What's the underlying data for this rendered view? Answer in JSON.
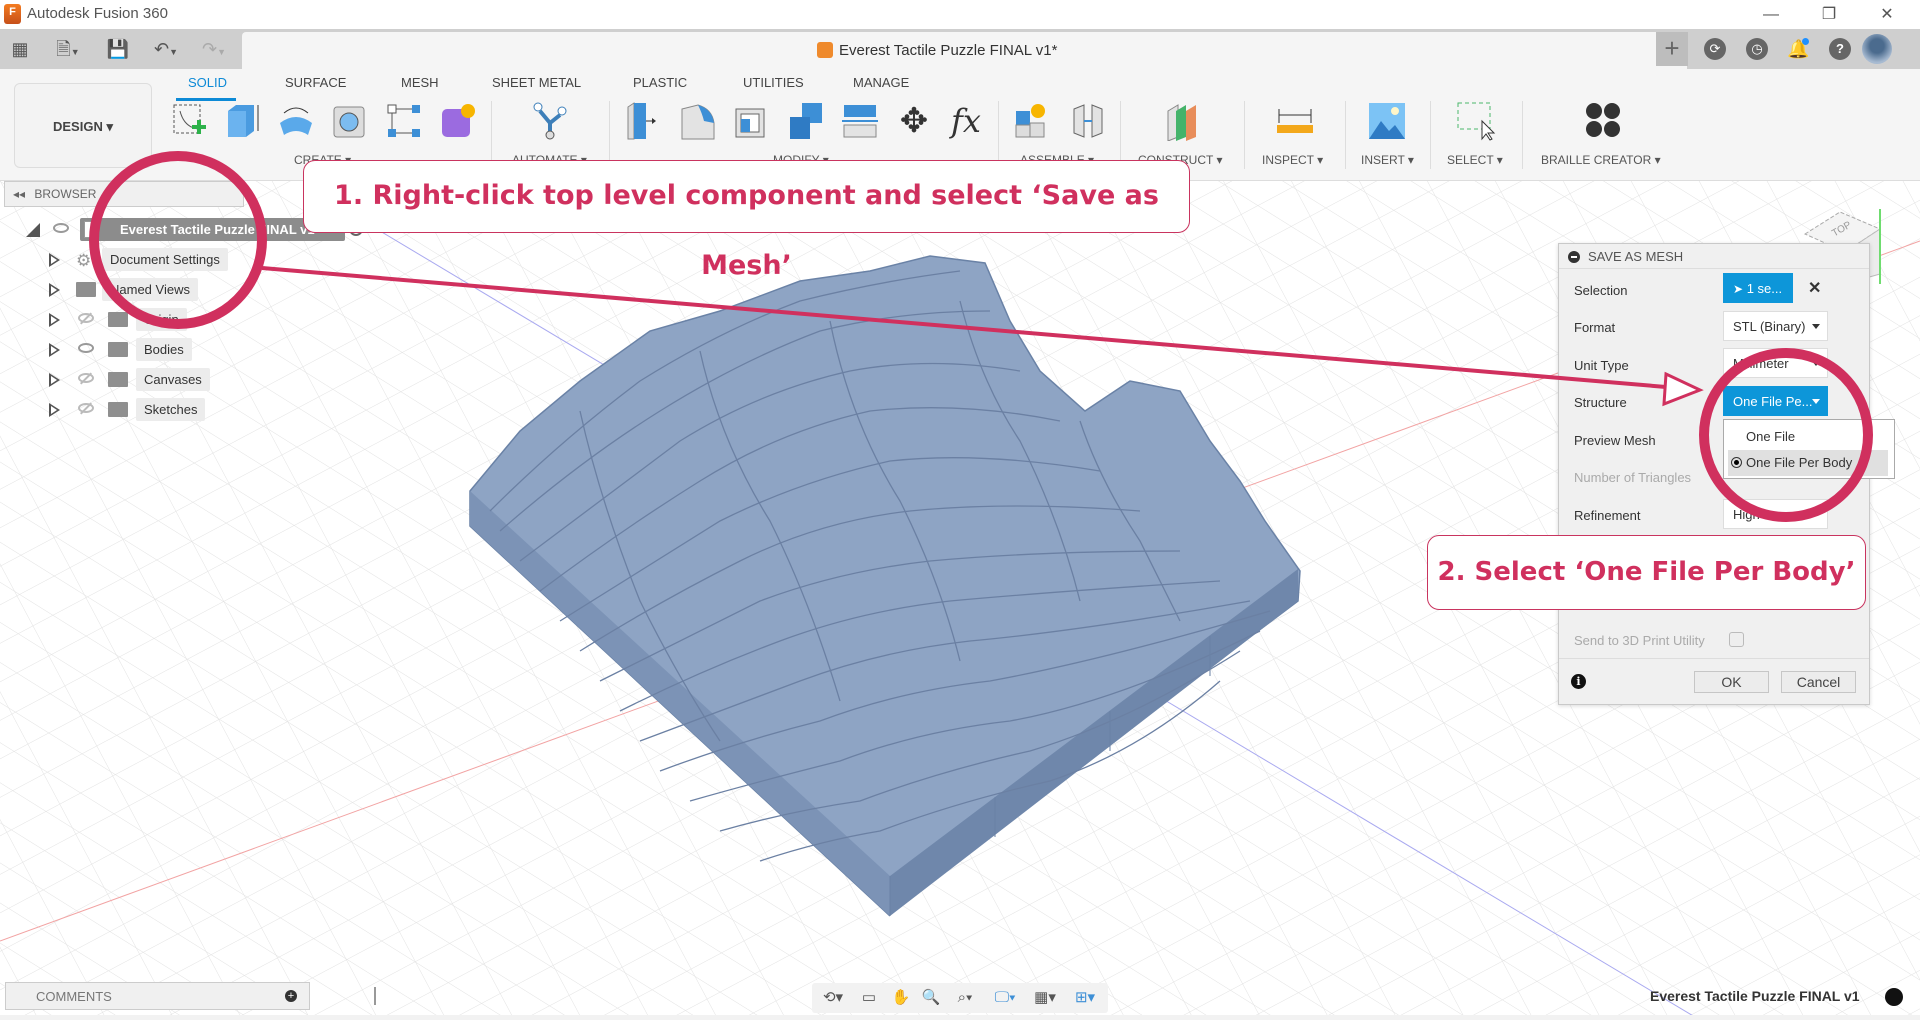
{
  "app": {
    "title": "Autodesk Fusion 360",
    "app_icon_letter": "F"
  },
  "window_controls": {
    "minimize": "—",
    "restore": "❐",
    "close": "✕"
  },
  "tabstrip": {
    "grid_icon": "▦",
    "file_icon": "🗎",
    "save_icon": "💾",
    "undo_icon": "↶",
    "redo_icon": "↷",
    "document_title": "Everest Tactile Puzzle FINAL v1*",
    "close_tab": "✕",
    "new_tab": "+",
    "right_icons": [
      "extensions-icon",
      "job-status-icon",
      "notifications-icon",
      "help-icon",
      "profile-avatar"
    ],
    "help_glyph": "?",
    "notification_color": "#1e90ff"
  },
  "ribbon": {
    "workspace_button": "DESIGN ▾",
    "tabs": [
      {
        "label": "SOLID",
        "active": true
      },
      {
        "label": "SURFACE",
        "active": false
      },
      {
        "label": "MESH",
        "active": false
      },
      {
        "label": "SHEET METAL",
        "active": false
      },
      {
        "label": "PLASTIC",
        "active": false
      },
      {
        "label": "UTILITIES",
        "active": false
      },
      {
        "label": "MANAGE",
        "active": false
      }
    ],
    "groups": {
      "create": "CREATE ▾",
      "automate": "AUTOMATE ▾",
      "modify": "MODIFY ▾",
      "assemble": "ASSEMBLE ▾",
      "construct": "CONSTRUCT ▾",
      "inspect": "INSPECT ▾",
      "insert": "INSERT ▾",
      "select": "SELECT ▾",
      "braille_creator": "BRAILLE CREATOR ▾"
    },
    "modify_fx_label": "fx",
    "accent_color": "#0d8ad6"
  },
  "browser": {
    "header": "BROWSER",
    "collapse_glyph": "◂◂",
    "root": "Everest Tactile Puzzle FINAL v1",
    "items": [
      {
        "label": "Document Settings",
        "visible": null
      },
      {
        "label": "Named Views",
        "visible": null
      },
      {
        "label": "Origin",
        "visible": false
      },
      {
        "label": "Bodies",
        "visible": true
      },
      {
        "label": "Canvases",
        "visible": false
      },
      {
        "label": "Sketches",
        "visible": false
      }
    ]
  },
  "viewcube": {
    "face_label": "TOP"
  },
  "dialog": {
    "title": "SAVE AS MESH",
    "rows": [
      {
        "label": "Selection",
        "value": "1 se...",
        "type": "selection"
      },
      {
        "label": "Format",
        "value": "STL (Binary)",
        "type": "dropdown"
      },
      {
        "label": "Unit Type",
        "value": "Millimeter",
        "type": "dropdown"
      },
      {
        "label": "Structure",
        "value": "One File Pe...",
        "type": "dropdown-open"
      },
      {
        "label": "Preview Mesh",
        "value": "",
        "type": "checkbox"
      },
      {
        "label": "Number of Triangles",
        "value": "",
        "type": "disabled"
      },
      {
        "label": "Refinement",
        "value": "High",
        "type": "dropdown"
      },
      {
        "label": "Send to 3D Print Utility",
        "value": "",
        "type": "checkbox-disabled"
      }
    ],
    "structure_options": [
      {
        "label": "One File",
        "selected": false
      },
      {
        "label": "One File Per Body",
        "selected": true
      }
    ],
    "clear_selection": "✕",
    "info_icon": "i",
    "ok": "OK",
    "cancel": "Cancel",
    "selection_color": "#0d96d9"
  },
  "annotations": {
    "step1": "1. Right-click top level component and select ‘Save as Mesh’",
    "step2": "2. Select ‘One File Per Body’",
    "color": "#d0305e"
  },
  "comments": {
    "label": "COMMENTS",
    "add": "+"
  },
  "navbar": {
    "icons": [
      "orbit-icon",
      "look-at-icon",
      "pan-icon",
      "zoom-icon",
      "fit-icon",
      "display-settings-icon",
      "grid-settings-icon",
      "viewports-icon"
    ]
  },
  "footer": {
    "document_name": "Everest Tactile Puzzle FINAL v1"
  }
}
